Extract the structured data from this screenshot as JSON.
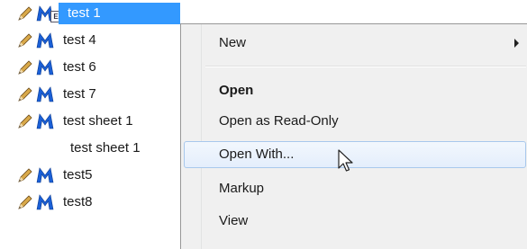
{
  "file_list": {
    "items": [
      {
        "name": "test 1",
        "pencil": true,
        "icon": "m-document-icon",
        "selected": true
      },
      {
        "name": "test 4",
        "pencil": true,
        "icon": "m-icon",
        "selected": false
      },
      {
        "name": "test 6",
        "pencil": true,
        "icon": "m-icon",
        "selected": false
      },
      {
        "name": "test 7",
        "pencil": true,
        "icon": "m-icon",
        "selected": false
      },
      {
        "name": "test sheet 1",
        "pencil": true,
        "icon": "m-icon",
        "selected": false
      },
      {
        "name": "test sheet 1",
        "pencil": false,
        "icon": "",
        "selected": false
      },
      {
        "name": "test5",
        "pencil": true,
        "icon": "m-icon",
        "selected": false
      },
      {
        "name": "test8",
        "pencil": true,
        "icon": "m-icon",
        "selected": false
      }
    ],
    "doc_badge_letter": "E"
  },
  "context_menu": {
    "items": [
      {
        "label": "New",
        "bold": false,
        "submenu": true,
        "hover": false
      },
      {
        "label": "Open",
        "bold": true,
        "submenu": false,
        "hover": false
      },
      {
        "label": "Open as Read-Only",
        "bold": false,
        "submenu": false,
        "hover": false
      },
      {
        "label": "Open With...",
        "bold": false,
        "submenu": false,
        "hover": true
      },
      {
        "label": "Markup",
        "bold": false,
        "submenu": false,
        "hover": false
      },
      {
        "label": "View",
        "bold": false,
        "submenu": false,
        "hover": false
      }
    ]
  },
  "colors": {
    "selection": "#3399ff",
    "menu_background": "#f0f0f0",
    "hover_border": "#a8c8ec",
    "m_icon_blue": "#1a5fd6",
    "pencil_wood": "#d9a94a"
  },
  "icons": {
    "pencil": "pencil-icon",
    "m": "m-icon",
    "cursor": "mouse-cursor-icon",
    "submenu": "submenu-arrow-icon"
  }
}
